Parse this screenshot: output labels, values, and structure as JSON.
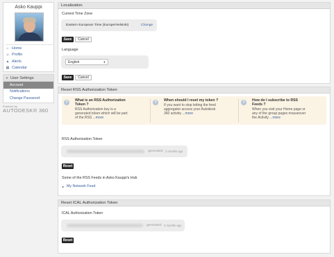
{
  "profile": {
    "name": "Asko Kauppi"
  },
  "nav": [
    {
      "icon": "home-icon",
      "glyph": "⌂",
      "label": "Home"
    },
    {
      "icon": "profile-icon",
      "glyph": "☺",
      "label": "Profile"
    },
    {
      "icon": "alerts-icon",
      "glyph": "▲",
      "label": "Alerts"
    },
    {
      "icon": "calendar-icon",
      "glyph": "▦",
      "label": "Calendar"
    }
  ],
  "settings": {
    "title": "User Settings",
    "items": [
      "Account",
      "Notifications",
      "Change Password"
    ],
    "active": "Account"
  },
  "branding": {
    "powered_by": "Powered by",
    "brand": "AUTODESK® 360"
  },
  "localization": {
    "header": "Localization",
    "timezone_label": "Current Time Zone",
    "timezone_value": "Eastern European Time (Europe/Helsinki)",
    "change_link": "Change",
    "save": "Save",
    "cancel": "Cancel",
    "language_label": "Language",
    "language_value": "English"
  },
  "rss": {
    "header": "Reset RSS Authorization Token",
    "faqs": [
      {
        "title_lines": [
          "What is an RSS Authorization",
          "Token ?"
        ],
        "body_lines": [
          "RSS Authorization key is a",
          "generated token which will be part"
        ],
        "last_line": "of the RSS ...",
        "more": "more"
      },
      {
        "title_lines": [
          "When should I reset my token ?"
        ],
        "body_lines": [
          "If you want to stop letting the feed",
          "aggregator access your Autodesk"
        ],
        "last_line": "360 activity ...",
        "more": "more"
      },
      {
        "title_lines": [
          "How do I subscribe to RSS",
          "Feeds ?"
        ],
        "body_lines": [
          "When you visit your Home page or",
          "any of the group pages mouseover"
        ],
        "last_line": "the Activity ...",
        "more": "more"
      }
    ],
    "token_label": "RSS Authorization Token",
    "generated": "generated",
    "time_ago": "2 months ago",
    "reset": "Reset",
    "feeds_label": "Some of the RSS Feeds in Asko Kauppi's Hub",
    "feed_link": "My Network Feed"
  },
  "ical": {
    "header": "Reset ICAL Authorization Token",
    "token_label": "ICAL Authorization Token",
    "generated": "generated",
    "time_ago": "2 months ago",
    "reset": "Reset"
  }
}
